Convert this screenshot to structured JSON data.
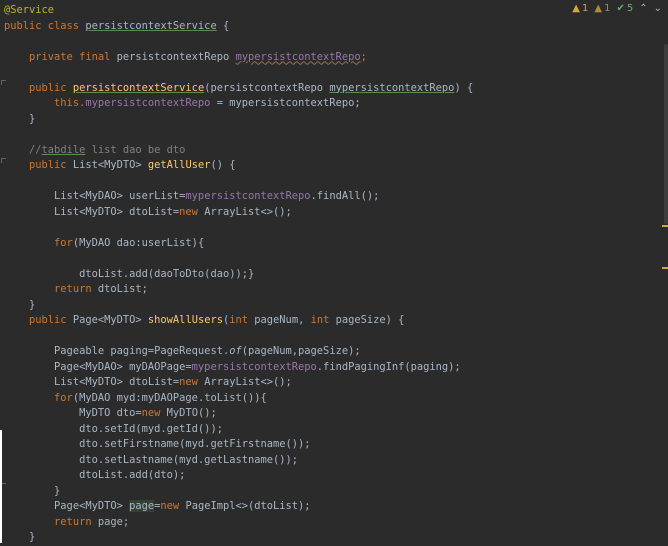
{
  "status": {
    "warnings": "1",
    "weak_warnings": "1",
    "ok": "5",
    "up": "^",
    "down": "v"
  },
  "code": {
    "l1": "@Service",
    "l2_a": "public class ",
    "l2_b": "persistcontextService",
    "l2_c": " {",
    "l4_a": "    private final ",
    "l4_b": "persistcontextRepo ",
    "l4_c": "mypersistcontextRepo",
    "l4_d": ";",
    "l6_a": "    public ",
    "l6_b": "persistcontextService",
    "l6_c": "(persistcontextRepo ",
    "l6_d": "mypersistcontextRepo",
    "l6_e": ") {",
    "l7_a": "        this.",
    "l7_b": "mypersistcontextRepo",
    "l7_c": " = mypersistcontextRepo;",
    "l8": "    }",
    "l10_a": "    //",
    "l10_b": "tabdile",
    "l10_c": " list dao be dto",
    "l11_a": "    public ",
    "l11_b": "List<MyDTO> ",
    "l11_c": "getAllUser",
    "l11_d": "() {",
    "l13_a": "        List<MyDAO> userList=",
    "l13_b": "mypersistcontextRepo",
    "l13_c": ".findAll();",
    "l14_a": "        List<MyDTO> dtoList=",
    "l14_b": "new ",
    "l14_c": "ArrayList<>();",
    "l16_a": "        for",
    "l16_b": "(MyDAO dao:userList){",
    "l18": "            dtoList.add(daoToDto(dao));}",
    "l19_a": "        return ",
    "l19_b": "dtoList;",
    "l20": "    }",
    "l21_a": "    public ",
    "l21_b": "Page<MyDTO> ",
    "l21_c": "showAllUsers",
    "l21_d": "(",
    "l21_e": "int ",
    "l21_f": "pageNum, ",
    "l21_g": "int ",
    "l21_h": "pageSize) {",
    "l23_a": "        Pageable paging=PageRequest.",
    "l23_b": "of",
    "l23_c": "(pageNum,pageSize);",
    "l24_a": "        Page<MyDAO> myDAOPage=",
    "l24_b": "mypersistcontextRepo",
    "l24_c": ".findPagingInf(paging);",
    "l25_a": "        List<MyDTO> dtoList=",
    "l25_b": "new ",
    "l25_c": "ArrayList<>();",
    "l26_a": "        for",
    "l26_b": "(MyDAO myd:myDAOPage.toList()){",
    "l27_a": "            MyDTO dto=",
    "l27_b": "new ",
    "l27_c": "MyDTO();",
    "l28": "            dto.setId(myd.getId());",
    "l29": "            dto.setFirstname(myd.getFirstname());",
    "l30": "            dto.setLastname(myd.getLastname());",
    "l31": "            dtoList.add(dto);",
    "l32": "        }",
    "l33_a": "        Page<MyDTO> ",
    "l33_b": "page",
    "l33_c": "=",
    "l33_d": "new ",
    "l33_e": "PageImpl<>(dtoList);",
    "l34_a": "        return ",
    "l34_b": "page;",
    "l35": "    }"
  },
  "colors": {
    "background": "#2b2b2b",
    "keyword": "#cc7832",
    "annotation": "#bbb529",
    "method": "#ffc66d",
    "field": "#9876aa",
    "comment": "#808080",
    "text": "#a9b7c6"
  }
}
